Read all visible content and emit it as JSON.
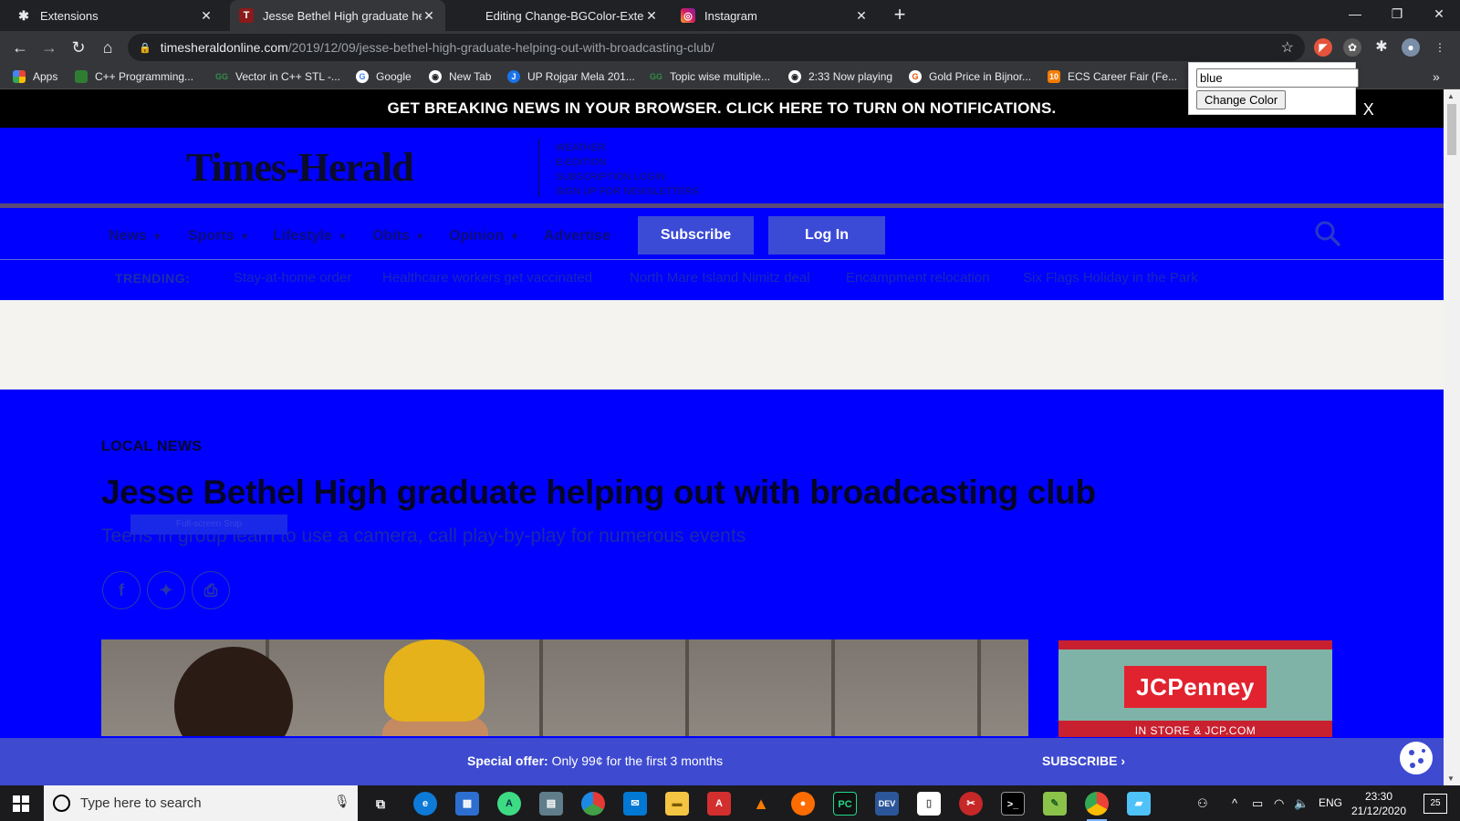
{
  "browser": {
    "tabs": [
      {
        "title": "Extensions",
        "active": false
      },
      {
        "title": "Jesse Bethel High graduate helpi",
        "active": true
      },
      {
        "title": "Editing Change-BGColor-Extensic",
        "active": false
      },
      {
        "title": "Instagram",
        "active": false
      }
    ],
    "url": {
      "host": "timesheraldonline.com",
      "path": "/2019/12/09/jesse-bethel-high-graduate-helping-out-with-broadcasting-club/"
    },
    "bookmarks": [
      "Apps",
      "C++ Programming...",
      "Vector in C++ STL -...",
      "Google",
      "New Tab",
      "UP Rojgar Mela 201...",
      "Topic wise multiple...",
      "2:33 Now playing",
      "Gold Price in Bijnor...",
      "ECS Career Fair (Fe..."
    ],
    "bookmarks_overflow": "»"
  },
  "extension_popup": {
    "input_value": "blue",
    "button_label": "Change Color"
  },
  "page": {
    "breaking_banner": "GET BREAKING NEWS IN YOUR BROWSER. CLICK HERE TO TURN ON NOTIFICATIONS.",
    "breaking_close": "X",
    "logo": "Times-Herald",
    "mast_links": [
      "WEATHER",
      "E-EDITION",
      "SUBSCRIPTION LOGIN",
      "SIGN UP FOR NEWSLETTERS"
    ],
    "nav": [
      {
        "label": "News",
        "caret": "▼"
      },
      {
        "label": "Sports",
        "caret": "▼"
      },
      {
        "label": "Lifestyle",
        "caret": "▼"
      },
      {
        "label": "Obits",
        "caret": "▼"
      },
      {
        "label": "Opinion",
        "caret": "▼"
      },
      {
        "label": "Advertise",
        "caret": ""
      }
    ],
    "subscribe_label": "Subscribe",
    "login_label": "Log In",
    "trending_label": "TRENDING:",
    "trending": [
      "Stay-at-home order",
      "Healthcare workers get vaccinated",
      "North Mare Island Nimitz deal",
      "Encampment relocation",
      "Six Flags Holiday in the Park"
    ],
    "section": "LOCAL NEWS",
    "headline": "Jesse Bethel High graduate helping out with broadcasting club",
    "subheadline": "Teens in group learn to use a camera, call play-by-play for numerous events",
    "snip_text": "Full-screen Snip",
    "ad": {
      "brand": "JCPenney",
      "tagline": "IN STORE & JCP.COM"
    },
    "offer": {
      "bold": "Special offer:",
      "text": " Only 99¢ for the first 3 months",
      "cta": "SUBSCRIBE ›"
    },
    "background_color": "#0000ff"
  },
  "taskbar": {
    "search_placeholder": "Type here to search",
    "language": "ENG",
    "time": "23:30",
    "date": "21/12/2020",
    "notifications": "25"
  }
}
